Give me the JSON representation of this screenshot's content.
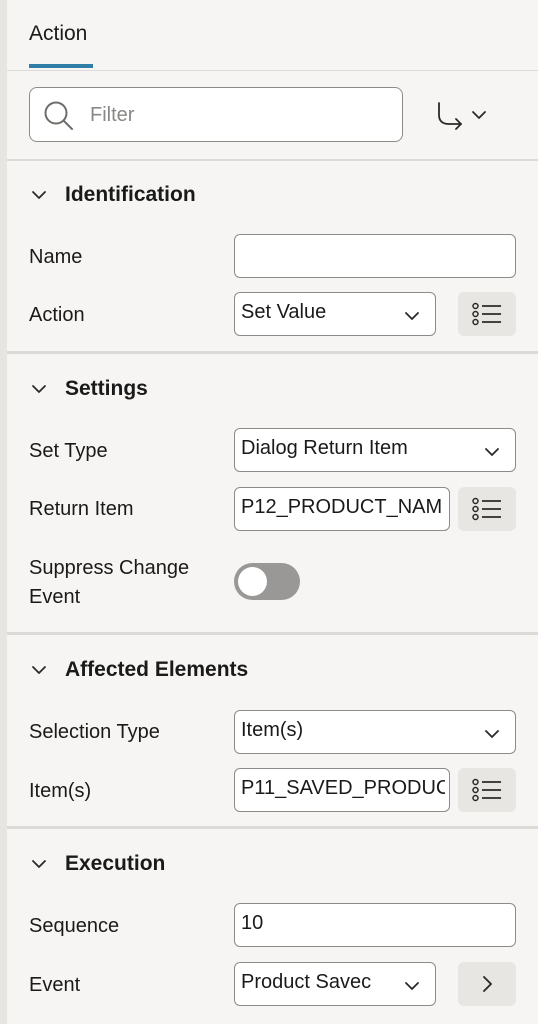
{
  "tabs": [
    {
      "label": "Action"
    }
  ],
  "filter": {
    "placeholder": "Filter",
    "value": ""
  },
  "sections": {
    "identification": {
      "title": "Identification",
      "name": {
        "label": "Name",
        "value": ""
      },
      "action": {
        "label": "Action",
        "value": "Set Value"
      }
    },
    "settings": {
      "title": "Settings",
      "set_type": {
        "label": "Set Type",
        "value": "Dialog Return Item"
      },
      "return_item": {
        "label": "Return Item",
        "value": "P12_PRODUCT_NAM"
      },
      "suppress_change_event": {
        "label_line1": "Suppress Change",
        "label_line2": "Event",
        "on": false
      }
    },
    "affected_elements": {
      "title": "Affected Elements",
      "selection_type": {
        "label": "Selection Type",
        "value": "Item(s)"
      },
      "items": {
        "label": "Item(s)",
        "value": "P11_SAVED_PRODUC"
      }
    },
    "execution": {
      "title": "Execution",
      "sequence": {
        "label": "Sequence",
        "value": "10"
      },
      "event": {
        "label": "Event",
        "value": "Product Savec"
      }
    }
  },
  "icons": {
    "search": "search-icon",
    "goto": "goto-arrow-icon",
    "chevron": "chevron-down-icon",
    "list": "list-icon",
    "next": "chevron-right-icon"
  },
  "colors": {
    "accent": "#2f7fa9",
    "toggle_off": "#9a9896",
    "background": "#f6f5f3"
  }
}
